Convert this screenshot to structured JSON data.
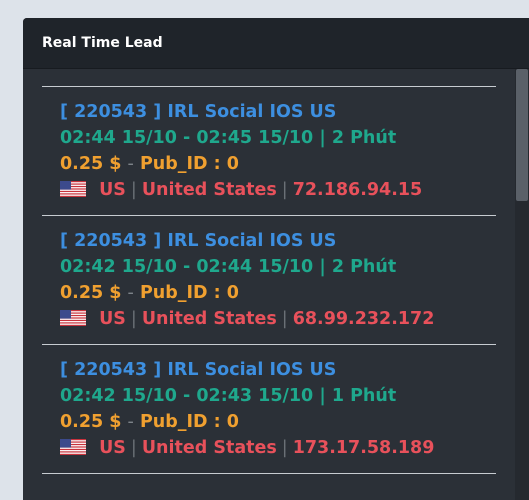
{
  "panel": {
    "title": "Real Time Lead"
  },
  "leads": [
    {
      "title": "[ 220543 ] IRL Social IOS US",
      "time": "02:44 15/10 - 02:45 15/10 | 2 Phút",
      "amount": "0.25 $",
      "pub_id": "Pub_ID : 0",
      "country_code": "US",
      "country_name": "United States",
      "ip": "72.186.94.15"
    },
    {
      "title": "[ 220543 ] IRL Social IOS US",
      "time": "02:42 15/10 - 02:44 15/10 | 2 Phút",
      "amount": "0.25 $",
      "pub_id": "Pub_ID : 0",
      "country_code": "US",
      "country_name": "United States",
      "ip": "68.99.232.172"
    },
    {
      "title": "[ 220543 ] IRL Social IOS US",
      "time": "02:42 15/10 - 02:43 15/10 | 1 Phút",
      "amount": "0.25 $",
      "pub_id": "Pub_ID : 0",
      "country_code": "US",
      "country_name": "United States",
      "ip": "173.17.58.189"
    }
  ],
  "separators": {
    "dash": "-",
    "pipe": "|"
  },
  "colors": {
    "title": "#3d8fe0",
    "time": "#1fa88d",
    "money": "#f0a030",
    "geo": "#e8515b",
    "panel_bg": "#2b3037",
    "header_bg": "#1f242a"
  },
  "icons": {
    "flag": "us-flag-icon"
  }
}
